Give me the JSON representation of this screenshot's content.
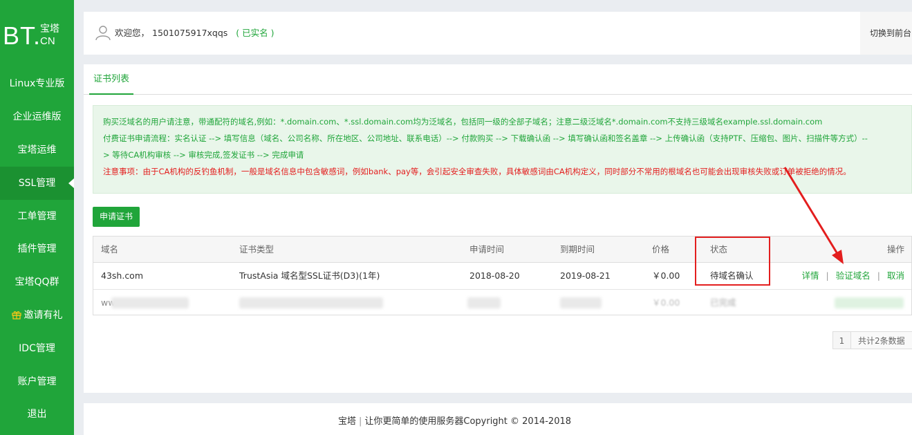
{
  "logo": {
    "main": "BT.",
    "top": "宝塔",
    "bottom": "CN"
  },
  "sidebar": {
    "items": [
      {
        "label": "Linux专业版"
      },
      {
        "label": "企业运维版"
      },
      {
        "label": "宝塔运维"
      },
      {
        "label": "SSL管理",
        "active": true
      },
      {
        "label": "工单管理"
      },
      {
        "label": "插件管理"
      },
      {
        "label": "宝塔QQ群"
      },
      {
        "label": "邀请有礼",
        "icon": "gift-icon"
      },
      {
        "label": "IDC管理"
      },
      {
        "label": "账户管理"
      },
      {
        "label": "退出"
      }
    ]
  },
  "header": {
    "welcome": "欢迎您，",
    "username": "1501075917xqqs",
    "verified": "( 已实名 )",
    "switch_front": "切换到前台"
  },
  "tabs": [
    {
      "label": "证书列表"
    }
  ],
  "notice": {
    "line1": "购买泛域名的用户请注意，带通配符的域名,例如：*.domain.com、*.ssl.domain.com均为泛域名，包括同一级的全部子域名；注意二级泛域名*.domain.com不支持三级域名example.ssl.domain.com",
    "line2": "付费证书申请流程：实名认证 --> 填写信息（域名、公司名称、所在地区、公司地址、联系电话）--> 付款购买 --> 下载确认函 --> 填写确认函和签名盖章 --> 上传确认函（支持PTF、压缩包、图片、扫描件等方式）--",
    "line3": "> 等待CA机构审核 --> 审核完成,签发证书 --> 完成申请",
    "line4": "注意事项：由于CA机构的反钓鱼机制，一般是域名信息中包含敏感词，例如bank、pay等，会引起安全审查失败，具体敏感词由CA机构定义，同时部分不常用的根域名也可能会出现审核失败或订单被拒绝的情况。"
  },
  "apply_button": "申请证书",
  "table": {
    "headers": {
      "domain": "域名",
      "type": "证书类型",
      "apply_time": "申请时间",
      "expire_time": "到期时间",
      "price": "价格",
      "status": "状态",
      "ops": "操作"
    },
    "rows": [
      {
        "domain": "43sh.com",
        "type": "TrustAsia 域名型SSL证书(D3)(1年)",
        "apply_time": "2018-08-20",
        "expire_time": "2019-08-21",
        "price": "￥0.00",
        "status": "待域名确认",
        "ops": {
          "detail": "详情",
          "verify": "验证域名",
          "cancel": "取消"
        }
      },
      {
        "domain": "ww",
        "price": "￥0.00",
        "status": "已完成"
      }
    ]
  },
  "pagination": {
    "page": "1",
    "total": "共计2条数据"
  },
  "footer": {
    "brand": "宝塔",
    "separator": "|",
    "text": "让你更简单的使用服务器Copyright © 2014-2018"
  },
  "colors": {
    "brand_green": "#20a53a",
    "annotation_red": "#e31e1e",
    "notice_bg": "#e9f6ea"
  }
}
